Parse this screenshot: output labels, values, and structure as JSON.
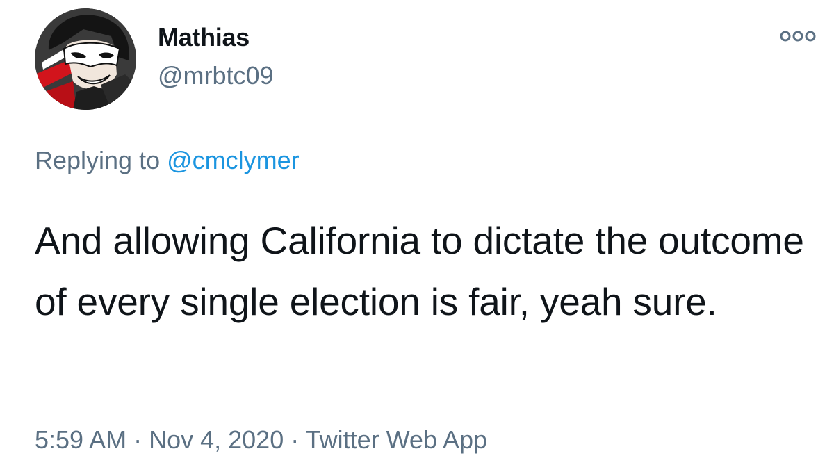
{
  "author": {
    "display_name": "Mathias",
    "handle": "@mrbtc09",
    "avatar_icon": "masked-character-avatar"
  },
  "more_icon": "more-options-icon",
  "reply": {
    "prefix": "Replying to ",
    "mention": "@cmclymer"
  },
  "tweet": {
    "text": "And allowing California to dictate the outcome of every single election is fair, yeah sure."
  },
  "meta": {
    "time": "5:59 AM",
    "separator1": " · ",
    "date": "Nov 4, 2020",
    "separator2": " · ",
    "source": "Twitter Web App"
  },
  "colors": {
    "text_primary": "#0f1419",
    "text_secondary": "#5b7083",
    "link": "#1b95e0"
  }
}
